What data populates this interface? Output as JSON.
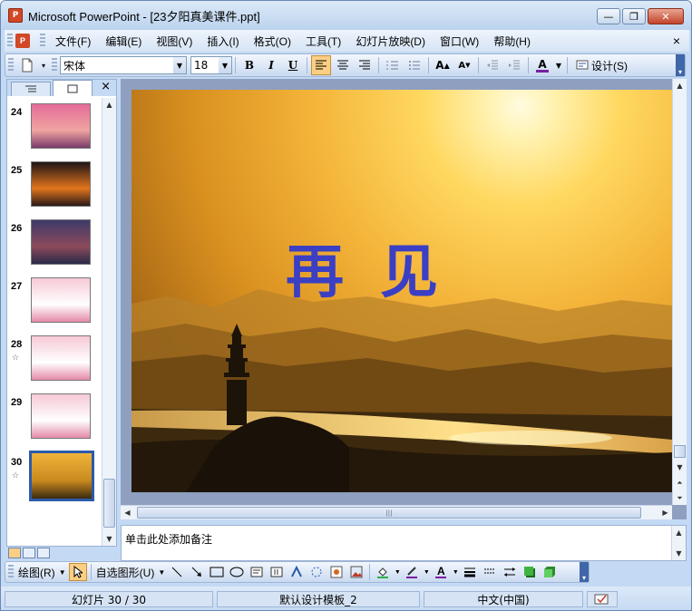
{
  "window": {
    "title": "Microsoft PowerPoint - [23夕阳真美课件.ppt]",
    "app_icon_label": "P"
  },
  "caption_buttons": {
    "minimize": "—",
    "restore": "❐",
    "close": "✕"
  },
  "menu": {
    "items": [
      "文件(F)",
      "编辑(E)",
      "视图(V)",
      "插入(I)",
      "格式(O)",
      "工具(T)",
      "幻灯片放映(D)",
      "窗口(W)",
      "帮助(H)"
    ],
    "close": "×"
  },
  "toolbar": {
    "font_name": "宋体",
    "font_size": "18",
    "bold": "B",
    "italic": "I",
    "underline": "U",
    "design_label": "设计(S)",
    "font_color": "#7a1fa2"
  },
  "outline_pane": {
    "tabs": [
      "outline",
      "slides"
    ],
    "close": "×",
    "thumbnails": [
      {
        "num": "24",
        "star": false,
        "colors": [
          "#e46b9a",
          "#f0a5a0",
          "#7a3a6a"
        ]
      },
      {
        "num": "25",
        "star": false,
        "colors": [
          "#1e1418",
          "#e2751c",
          "#2a1a18"
        ]
      },
      {
        "num": "26",
        "star": false,
        "colors": [
          "#3d3a6a",
          "#8d4a5a",
          "#2a2a4a"
        ]
      },
      {
        "num": "27",
        "star": false,
        "colors": [
          "#f6c9d6",
          "#ffffff",
          "#e48aa8"
        ]
      },
      {
        "num": "28",
        "star": true,
        "colors": [
          "#f6c9d6",
          "#ffffff",
          "#e48aa8"
        ]
      },
      {
        "num": "29",
        "star": false,
        "colors": [
          "#f6c9d6",
          "#ffffff",
          "#e48aa8"
        ]
      },
      {
        "num": "30",
        "star": true,
        "current": true,
        "colors": [
          "#f0b43a",
          "#c98a1e",
          "#3b2a10"
        ]
      }
    ]
  },
  "slide": {
    "title": "再见"
  },
  "notes": {
    "placeholder": "单击此处添加备注"
  },
  "drawing_toolbar": {
    "draw_label": "绘图(R)",
    "autoshape_label": "自选图形(U)"
  },
  "status": {
    "slide": "幻灯片 30 / 30",
    "template": "默认设计模板_2",
    "language": "中文(中国)"
  }
}
